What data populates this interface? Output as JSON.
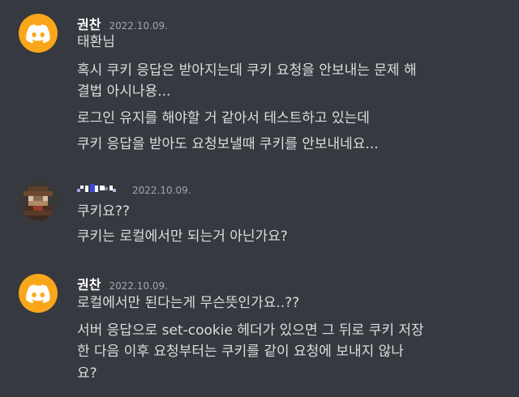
{
  "messages": [
    {
      "username": "권찬",
      "timestamp": "2022.10.09.",
      "avatar": "discord-logo-icon",
      "lines": [
        "태환님",
        "혹시 쿠키 응답은 받아지는데 쿠키 요청을 안보내는 문제 해",
        "결법 아시나용...",
        "로그인 유지를 해야할 거 같아서 테스트하고 있는데",
        "쿠키 응답을 받아도 요청보낼때 쿠키를 안보내네요..."
      ]
    },
    {
      "username": "",
      "timestamp": "2022.10.09.",
      "avatar": "pixelated-user-avatar",
      "lines": [
        "쿠키요??",
        "쿠키는 로컬에서만 되는거 아닌가요?"
      ]
    },
    {
      "username": "권찬",
      "timestamp": "2022.10.09.",
      "avatar": "discord-logo-icon",
      "lines": [
        "로컬에서만 된다는게 무슨뜻인가요..??",
        "서버 응답으로 set-cookie 헤더가 있으면 그 뒤로 쿠키 저장",
        "한 다음 이후 요청부터는 쿠키를 같이 요청에 보내지 않나",
        "요?"
      ]
    }
  ],
  "colors": {
    "background": "#36393f",
    "avatar_discord": "#faa61a",
    "username": "#ffffff",
    "text": "#dcddde",
    "timestamp": "#a3a6aa"
  }
}
